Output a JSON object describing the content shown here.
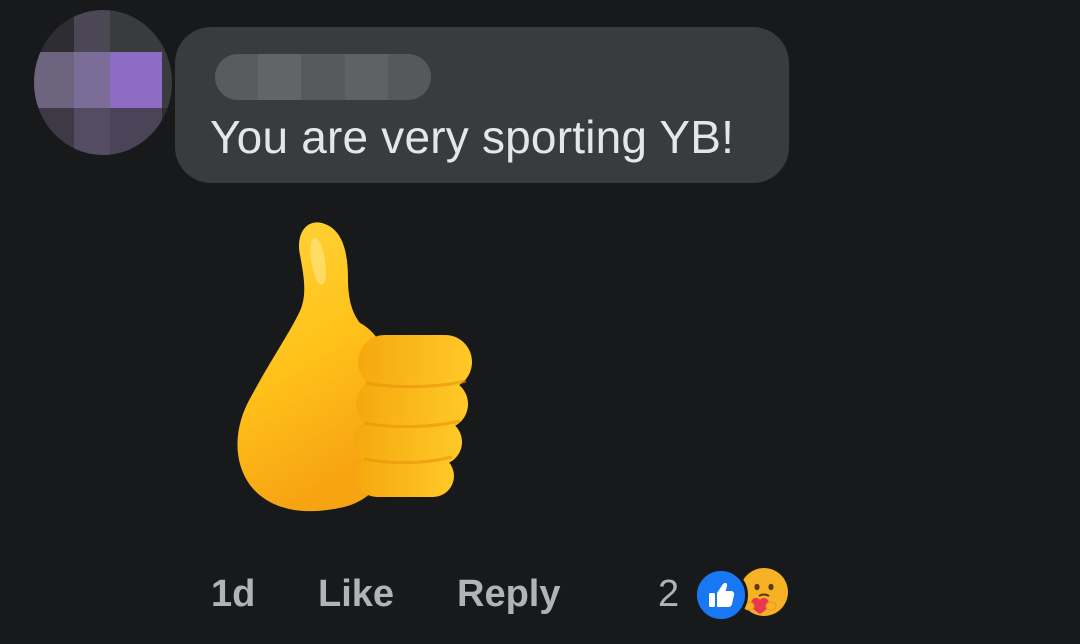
{
  "comment": {
    "author_name": "",
    "text": "You are very sporting YB!",
    "sticker": "thumbs-up-icon"
  },
  "footer": {
    "time": "1d",
    "like_label": "Like",
    "reply_label": "Reply",
    "reaction_count": "2",
    "reactions": [
      "like-reaction-icon",
      "care-reaction-icon"
    ]
  },
  "colors": {
    "background": "#18191a",
    "bubble": "#3a3b3c",
    "text": "#e4e6eb",
    "secondary_text": "#b0b3b8",
    "like_blue": "#1877f2"
  }
}
